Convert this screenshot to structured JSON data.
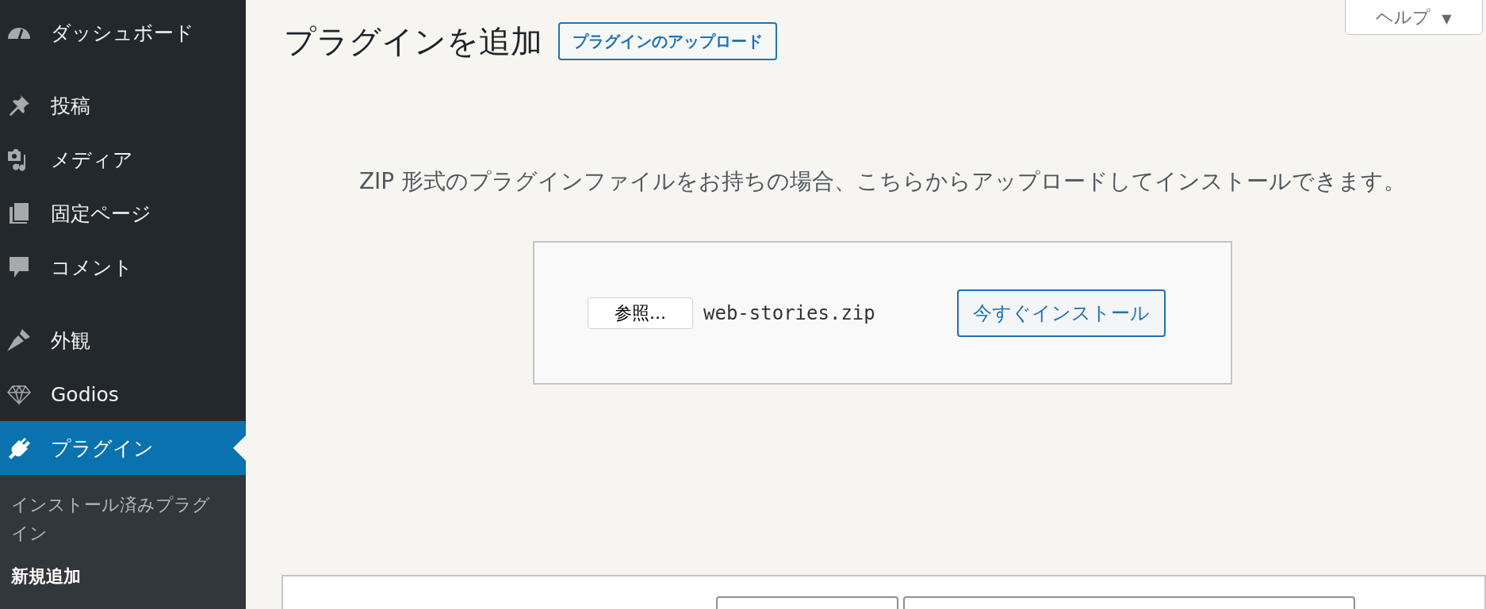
{
  "sidebar": {
    "groups": [
      [
        {
          "label": "ダッシュボード",
          "selected": false
        }
      ],
      [
        {
          "label": "投稿",
          "selected": false
        },
        {
          "label": "メディア",
          "selected": false
        },
        {
          "label": "固定ページ",
          "selected": false
        },
        {
          "label": "コメント",
          "selected": false
        }
      ],
      [
        {
          "label": "外観",
          "selected": false
        },
        {
          "label": "Godios",
          "selected": false
        },
        {
          "label": "プラグイン",
          "selected": true,
          "submenu": [
            {
              "label": "インストール済みプラグイン",
              "selected": false
            },
            {
              "label": "新規追加",
              "selected": true
            }
          ]
        }
      ]
    ]
  },
  "help_button": {
    "label": "ヘルプ",
    "arrow": "▼"
  },
  "page_title": "プラグインを追加",
  "upload_button": "プラグインのアップロード",
  "description": "ZIP 形式のプラグインファイルをお持ちの場合、こちらからアップロードしてインストールできます。",
  "upload_form": {
    "browse_button": "参照...",
    "file_name": "web-stories.zip",
    "install_button": "今すぐインストール"
  }
}
